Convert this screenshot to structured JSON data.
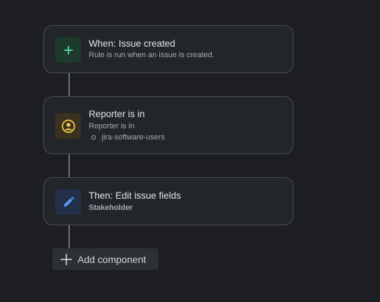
{
  "rule": {
    "trigger": {
      "title": "When: Issue created",
      "description": "Rule is run when an issue is created.",
      "icon": "plus-icon",
      "icon_color": "#4bce97",
      "icon_bg": "#1e3a2c"
    },
    "condition": {
      "title": "Reporter is in",
      "description": "Reporter is in",
      "values": [
        "jira-software-users"
      ],
      "icon": "user-circle-icon",
      "icon_color": "#f5cd47",
      "icon_bg": "#3a3121"
    },
    "action": {
      "title": "Then: Edit issue fields",
      "description": "Stakeholder",
      "icon": "pencil-icon",
      "icon_color": "#579dff",
      "icon_bg": "#243049"
    }
  },
  "add_component": {
    "label": "Add component",
    "icon": "plus-icon"
  },
  "colors": {
    "background": "#1d1e21",
    "card_background": "#22262b",
    "card_border": "#4a4e55",
    "connector": "#6f737a"
  }
}
